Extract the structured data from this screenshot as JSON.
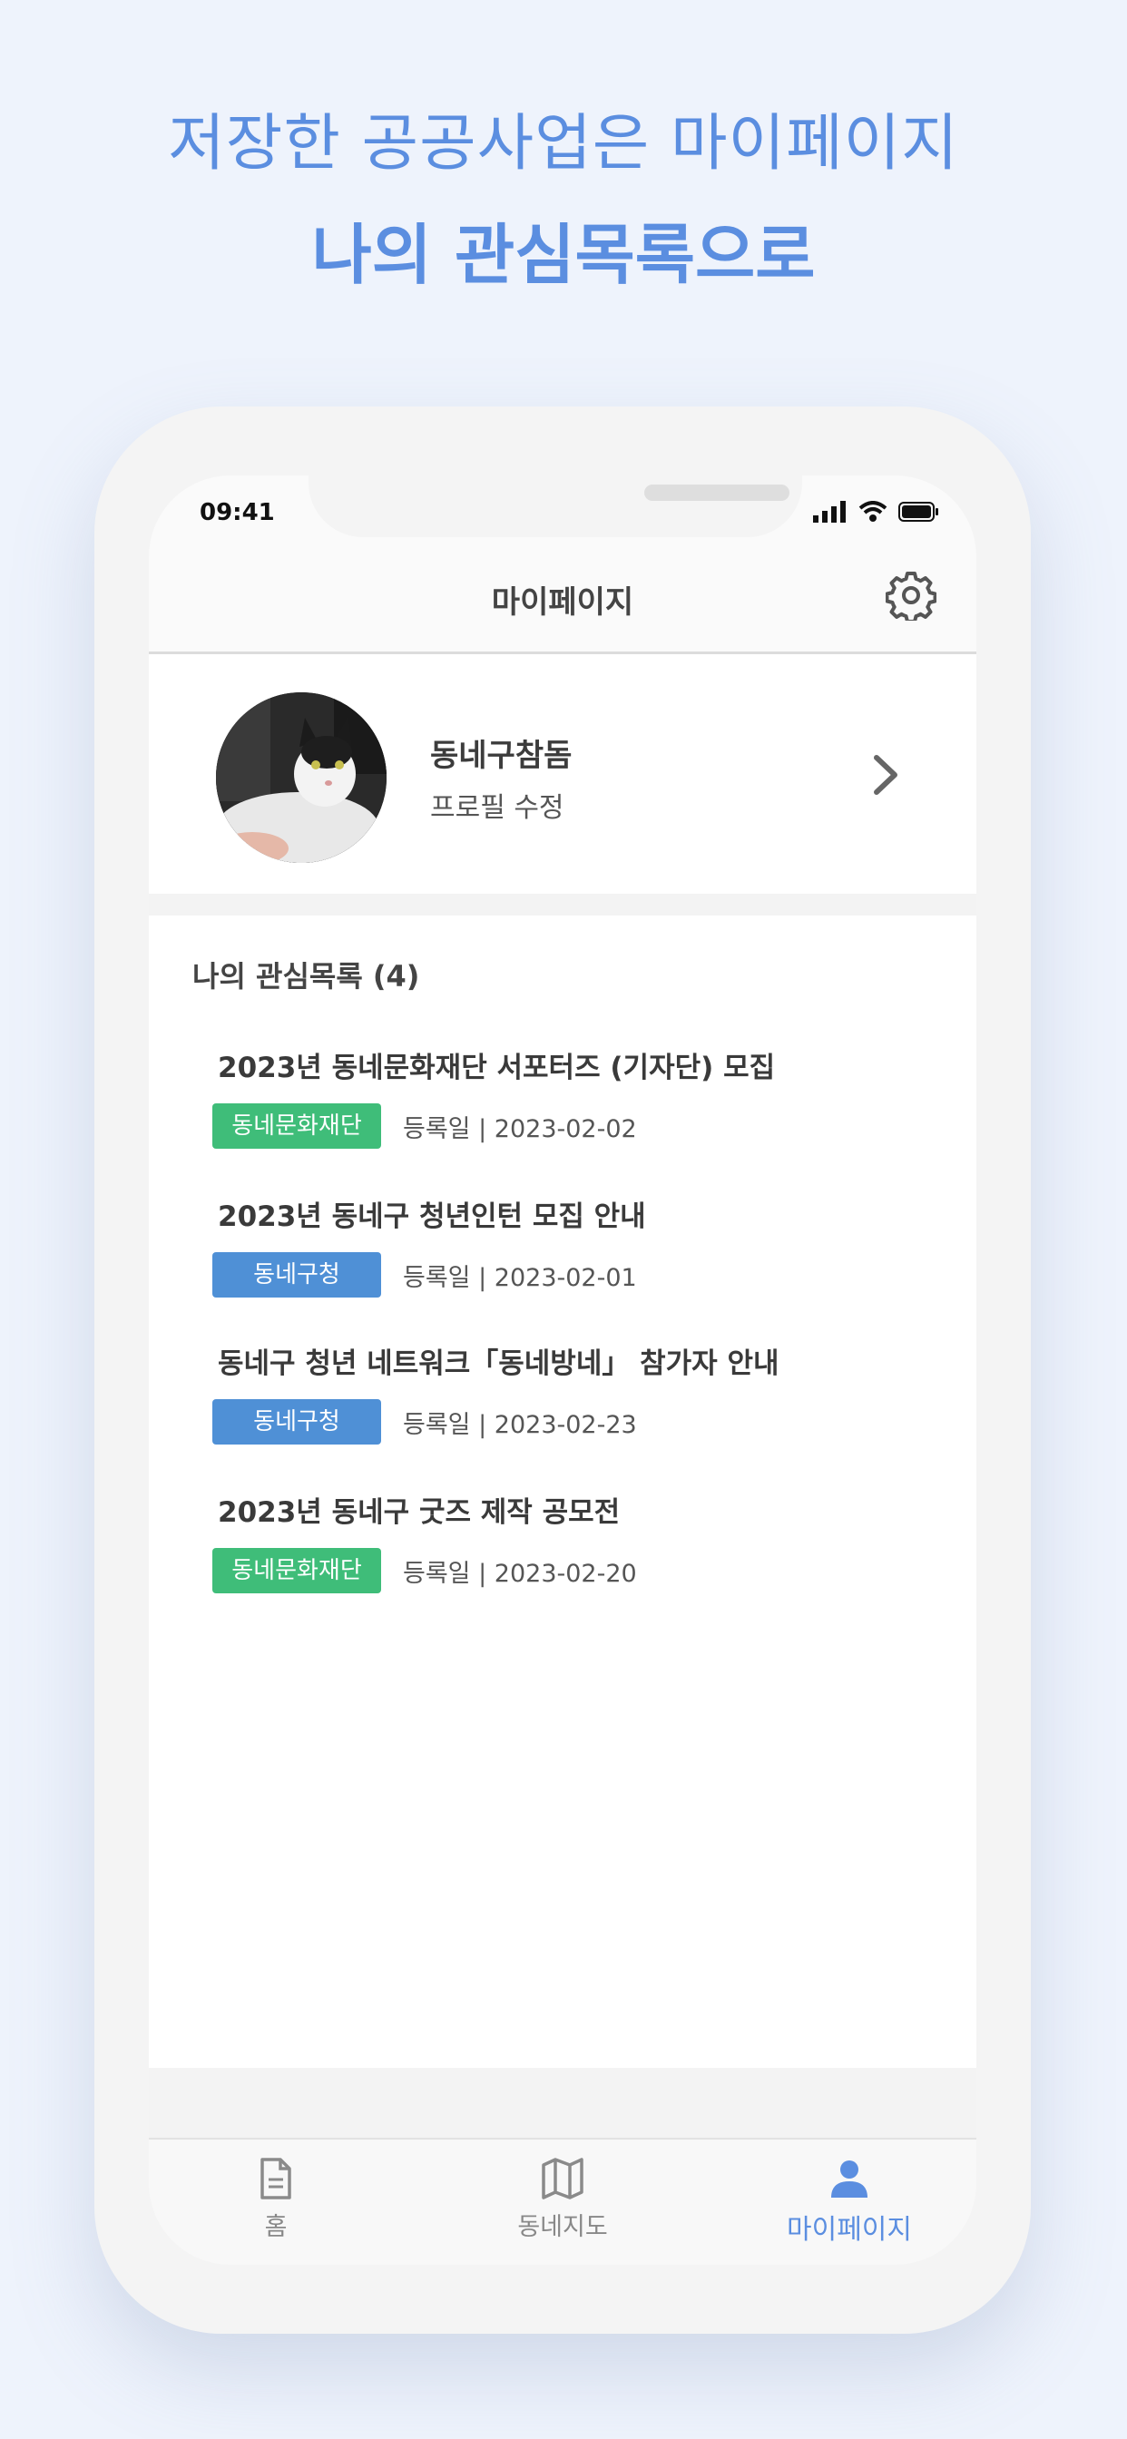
{
  "promo": {
    "line1": "저장한 공공사업은 마이페이지",
    "line2": "나의 관심목록으로"
  },
  "status_bar": {
    "time": "09:41"
  },
  "app_bar": {
    "title": "마이페이지"
  },
  "profile": {
    "nickname": "동네구참돔",
    "edit_label": "프로필 수정"
  },
  "favorites": {
    "title": "나의 관심목록 (4)",
    "items": [
      {
        "title": "2023년 동네문화재단 서포터즈 (기자단) 모집",
        "badge": "동네문화재단",
        "badge_color": "#3fbd79",
        "date": "등록일 | 2023-02-02"
      },
      {
        "title": "2023년 동네구 청년인턴 모집 안내",
        "badge": "동네구청",
        "badge_color": "#4f90d6",
        "date": "등록일 | 2023-02-01"
      },
      {
        "title": "동네구 청년 네트워크「동네방네」 참가자 안내",
        "badge": "동네구청",
        "badge_color": "#4f90d6",
        "date": "등록일 | 2023-02-23"
      },
      {
        "title": "2023년 동네구 굿즈 제작 공모전",
        "badge": "동네문화재단",
        "badge_color": "#3fbd79",
        "date": "등록일 | 2023-02-20"
      }
    ]
  },
  "tabs": [
    {
      "label": "홈",
      "icon": "document-icon"
    },
    {
      "label": "동네지도",
      "icon": "map-icon"
    },
    {
      "label": "마이페이지",
      "icon": "person-icon",
      "active": true
    }
  ],
  "colors": {
    "accent": "#5b8ee0",
    "green_badge": "#3fbd79",
    "blue_badge": "#4f90d6",
    "background": "#eef3fc"
  }
}
